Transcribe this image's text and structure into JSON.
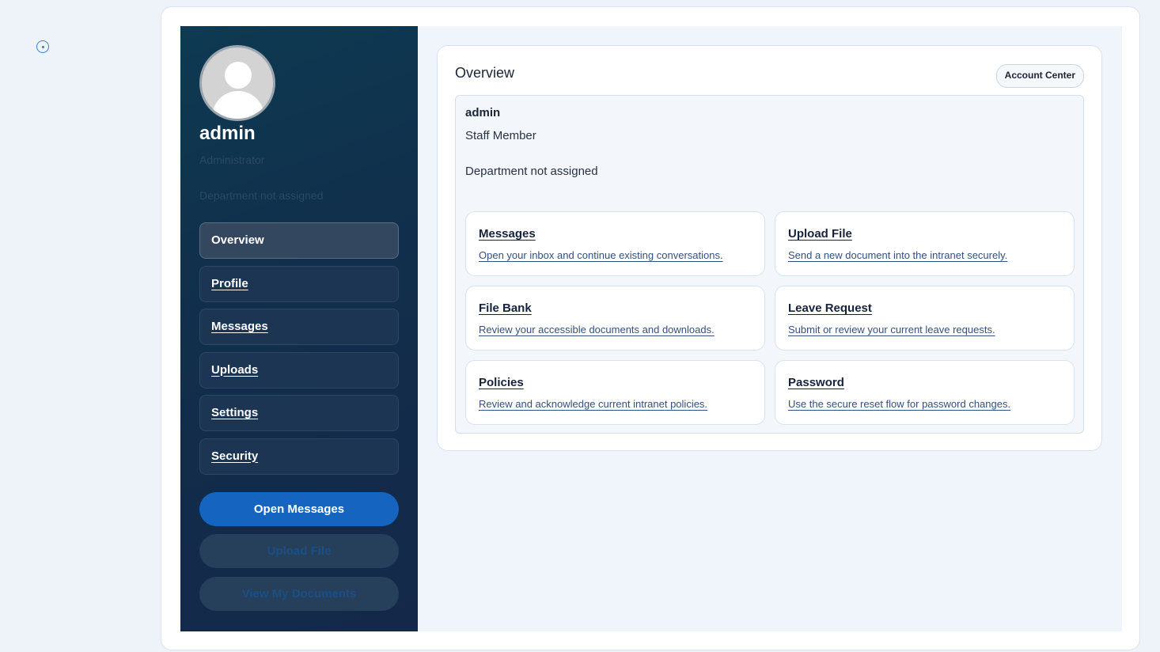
{
  "user": {
    "name": "admin",
    "role": "Administrator",
    "department": "Department not assigned"
  },
  "nav": {
    "items": [
      {
        "label": "Overview",
        "active": true
      },
      {
        "label": "Profile"
      },
      {
        "label": "Messages"
      },
      {
        "label": "Uploads"
      },
      {
        "label": "Settings"
      },
      {
        "label": "Security"
      }
    ]
  },
  "actions": {
    "open_messages": "Open Messages",
    "upload_file": "Upload File",
    "view_documents": "View My Documents"
  },
  "overview": {
    "title": "Overview",
    "account_center": "Account Center",
    "name": "admin",
    "role": "Staff Member",
    "department": "Department not assigned",
    "tiles": [
      {
        "title": "Messages",
        "desc": "Open your inbox and continue existing conversations."
      },
      {
        "title": "Upload File",
        "desc": "Send a new document into the intranet securely."
      },
      {
        "title": "File Bank",
        "desc": "Review your accessible documents and downloads."
      },
      {
        "title": "Leave Request",
        "desc": "Submit or review your current leave requests."
      },
      {
        "title": "Policies",
        "desc": "Review and acknowledge current intranet policies."
      },
      {
        "title": "Password",
        "desc": "Use the secure reset flow for password changes."
      }
    ]
  },
  "colors": {
    "accent": "#1565c0",
    "sidebar_bg": "#132b4a",
    "page_bg": "#eef3f9"
  },
  "icons": {
    "corner": "target-icon",
    "avatar": "user-silhouette-icon"
  }
}
